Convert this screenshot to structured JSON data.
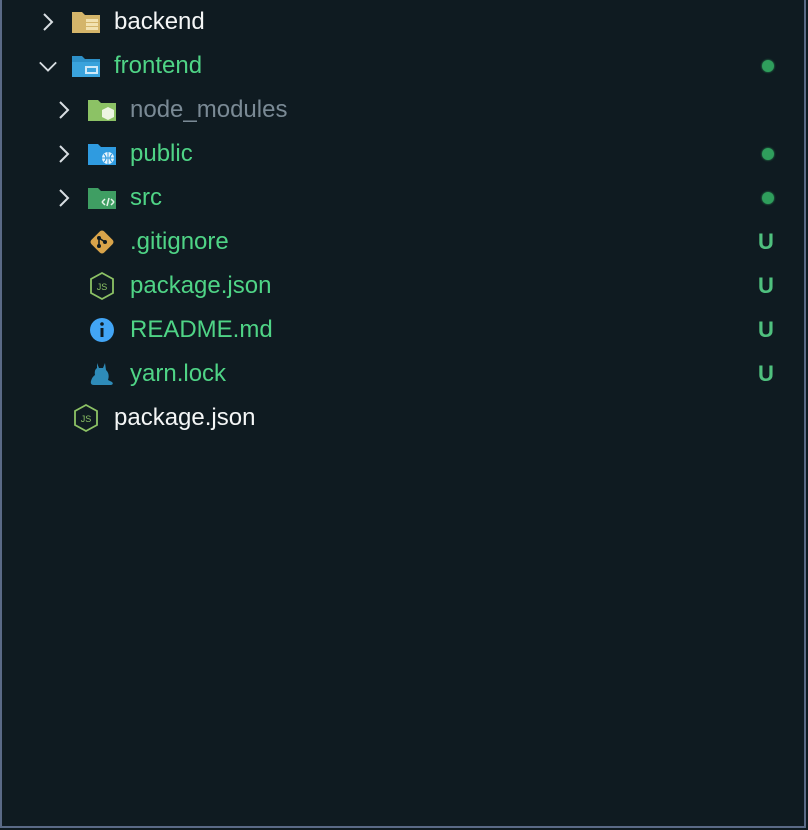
{
  "colors": {
    "background": "#0f1b21",
    "untracked_green": "#4fd486",
    "default_white": "#f4f6f6",
    "ignored_gray": "#7a8a95",
    "badge_green": "#4fc07e",
    "dot_green": "#2f9e5c"
  },
  "tree": {
    "backend": {
      "label": "backend",
      "icon": "folder-server-icon",
      "chevron": "chevron-right-icon"
    },
    "frontend": {
      "label": "frontend",
      "icon": "folder-client-icon",
      "chevron": "chevron-down-icon"
    },
    "node_modules": {
      "label": "node_modules",
      "icon": "folder-node-icon",
      "chevron": "chevron-right-icon"
    },
    "public": {
      "label": "public",
      "icon": "folder-public-icon",
      "chevron": "chevron-right-icon"
    },
    "src": {
      "label": "src",
      "icon": "folder-src-icon",
      "chevron": "chevron-right-icon"
    },
    "gitignore": {
      "label": ".gitignore",
      "icon": "git-icon",
      "status": "U"
    },
    "frontend_package_json": {
      "label": "package.json",
      "icon": "nodejs-icon",
      "status": "U"
    },
    "readme": {
      "label": "README.md",
      "icon": "info-icon",
      "status": "U"
    },
    "yarn_lock": {
      "label": "yarn.lock",
      "icon": "yarn-cat-icon",
      "status": "U"
    },
    "root_package_json": {
      "label": "package.json",
      "icon": "nodejs-icon"
    }
  }
}
